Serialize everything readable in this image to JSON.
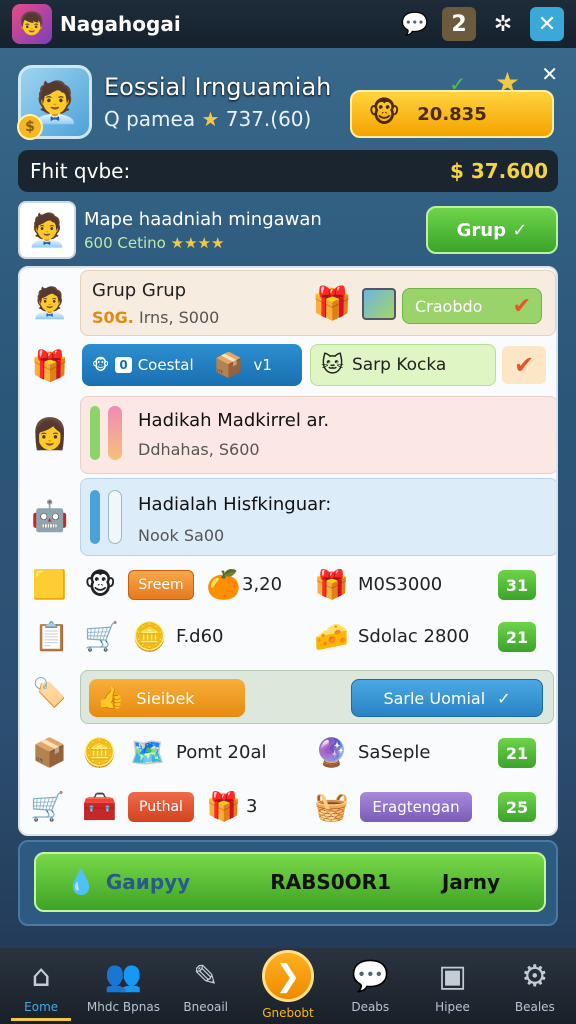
{
  "topbar": {
    "app_title": "Nagahogai",
    "level": "2",
    "icons": [
      "chat-icon",
      "level-badge",
      "sparkle-icon",
      "close-icon"
    ]
  },
  "profile": {
    "name": "Eossial Irnguamiah",
    "sub_prefix": "Q pamea",
    "sub_value": "737.(60)",
    "gold_value": "20.835"
  },
  "balance": {
    "label": "Fhit qvbe:",
    "value": "$ 37.600"
  },
  "mission": {
    "title": "Mape haadniah mingawan",
    "sub": "600 Cetino",
    "button": "Grup"
  },
  "panel": {
    "row1": {
      "title": "Grup Grup",
      "sub_orange": "S0G.",
      "sub": "Irns, S000",
      "button": "Craobdo"
    },
    "row2": {
      "blue_chip": "0",
      "blue_label": "Coestal",
      "blue_suffix": "v1",
      "green_label": "Sarp Kocka"
    },
    "row3": {
      "title": "Hadikah Madkirrel ar.",
      "sub": "Ddhahas, S600"
    },
    "row4": {
      "title": "Hadialah Hisfkinguar:",
      "sub": "Nook Sa00"
    },
    "grid1": {
      "button": "Sreem",
      "mid_value": "3,20",
      "right_label": "M0S3000",
      "badge": "31"
    },
    "grid2": {
      "mid_value": "F.d60",
      "right_label": "Sdolac 2800",
      "badge": "21"
    },
    "grid3": {
      "left_button": "Sieibek",
      "right_button": "Sarle Uomial"
    },
    "grid4": {
      "mid_value": "Pomt 20al",
      "right_label": "SaSeple",
      "badge": "21"
    },
    "grid5": {
      "left_button": "Puthal",
      "mid_value": "3",
      "right_button": "Eragtengan",
      "badge": "25"
    }
  },
  "cta": {
    "left": "Gaируу",
    "center": "RABS0OR1",
    "right": "Jarny"
  },
  "nav": [
    {
      "label": "Eome",
      "icon": "home-icon"
    },
    {
      "label": "Mhdc Bpnas",
      "icon": "friends-icon"
    },
    {
      "label": "Bneoail",
      "icon": "quest-icon"
    },
    {
      "label": "Gnebobt",
      "icon": "play-icon"
    },
    {
      "label": "Deabs",
      "icon": "chat-icon"
    },
    {
      "label": "Hipee",
      "icon": "camera-icon"
    },
    {
      "label": "Beales",
      "icon": "settings-icon"
    }
  ],
  "colors": {
    "accent_green": "#3aa42a",
    "accent_orange": "#f08a00",
    "accent_blue": "#2a84c4",
    "gold": "#f5c842"
  }
}
